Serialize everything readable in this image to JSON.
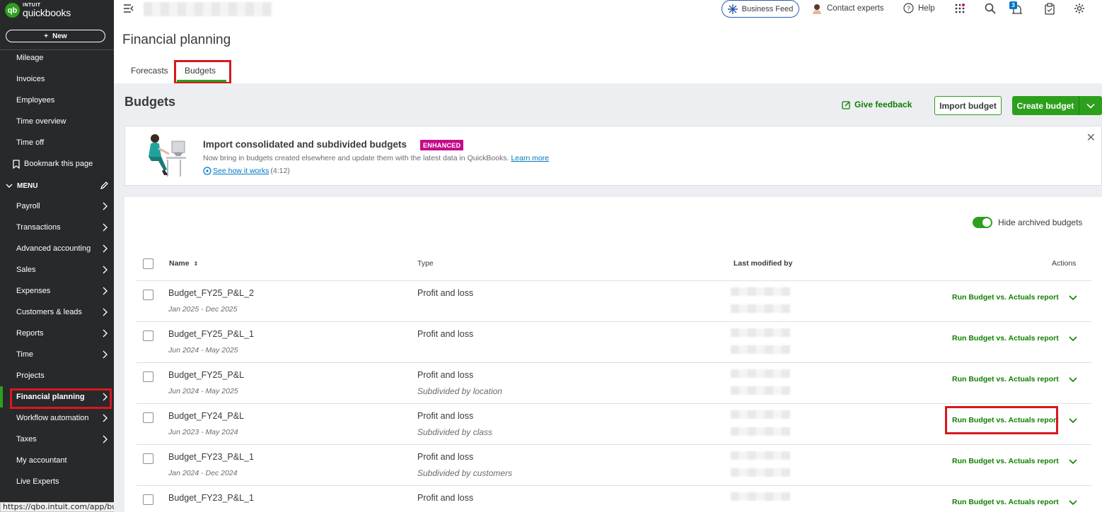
{
  "app": {
    "brand_small": "INTUIT",
    "brand_large": "quickbooks",
    "new_label": "New"
  },
  "sidebar": {
    "items_top": [
      "Mileage",
      "Invoices",
      "Employees",
      "Time overview",
      "Time off"
    ],
    "bookmark": "Bookmark this page",
    "menu_label": "MENU",
    "menu_items": [
      {
        "label": "Payroll",
        "chevron": true
      },
      {
        "label": "Transactions",
        "chevron": true
      },
      {
        "label": "Advanced accounting",
        "chevron": true
      },
      {
        "label": "Sales",
        "chevron": true
      },
      {
        "label": "Expenses",
        "chevron": true
      },
      {
        "label": "Customers & leads",
        "chevron": true
      },
      {
        "label": "Reports",
        "chevron": true
      },
      {
        "label": "Time",
        "chevron": true
      },
      {
        "label": "Projects",
        "chevron": false
      },
      {
        "label": "Financial planning",
        "chevron": true,
        "active": true
      },
      {
        "label": "Workflow automation",
        "chevron": true
      },
      {
        "label": "Taxes",
        "chevron": true
      },
      {
        "label": "My accountant",
        "chevron": false
      },
      {
        "label": "Live Experts",
        "chevron": false
      }
    ],
    "status_url": "https://qbo.intuit.com/app/budgets"
  },
  "topbar": {
    "business_feed": "Business Feed",
    "contact": "Contact experts",
    "help": "Help",
    "notification_count": "3"
  },
  "page": {
    "title": "Financial planning",
    "tabs": [
      "Forecasts",
      "Budgets"
    ],
    "active_tab": "Budgets"
  },
  "budgets": {
    "title": "Budgets",
    "give_feedback": "Give feedback",
    "import_label": "Import budget",
    "create_label": "Create budget",
    "banner": {
      "title": "Import consolidated and subdivided budgets",
      "badge": "ENHANCED",
      "desc": "Now bring in budgets created elsewhere and update them with the latest data in QuickBooks.",
      "learn_more": "Learn more",
      "see_how": "See how it works",
      "duration": "(4:12)"
    },
    "hide_archived": "Hide archived budgets",
    "columns": {
      "name": "Name",
      "type": "Type",
      "modified": "Last modified by",
      "actions": "Actions"
    },
    "rows": [
      {
        "name": "Budget_FY25_P&L_2",
        "range": "Jan 2025 - Dec 2025",
        "type": "Profit and loss",
        "sub": "",
        "action": "Run Budget vs. Actuals report"
      },
      {
        "name": "Budget_FY25_P&L_1",
        "range": "Jun 2024 - May 2025",
        "type": "Profit and loss",
        "sub": "",
        "action": "Run Budget vs. Actuals report"
      },
      {
        "name": "Budget_FY25_P&L",
        "range": "Jun 2024 - May 2025",
        "type": "Profit and loss",
        "sub": "Subdivided by location",
        "action": "Run Budget vs. Actuals report"
      },
      {
        "name": "Budget_FY24_P&L",
        "range": "Jun 2023 - May 2024",
        "type": "Profit and loss",
        "sub": "Subdivided by class",
        "action": "Run Budget vs. Actuals report",
        "highlighted": true
      },
      {
        "name": "Budget_FY23_P&L_1",
        "range": "Jan 2024 - Dec 2024",
        "type": "Profit and loss",
        "sub": "Subdivided by customers",
        "action": "Run Budget vs. Actuals report"
      },
      {
        "name": "Budget_FY23_P&L_1",
        "range": "",
        "type": "Profit and loss",
        "sub": "",
        "action": "Run Budget vs. Actuals report"
      }
    ]
  },
  "colors": {
    "sidebar_bg": "#28292b",
    "accent_green": "#2ca01c",
    "link_green": "#108000",
    "highlight_red": "#d9181f",
    "badge_magenta": "#c40c8a"
  }
}
